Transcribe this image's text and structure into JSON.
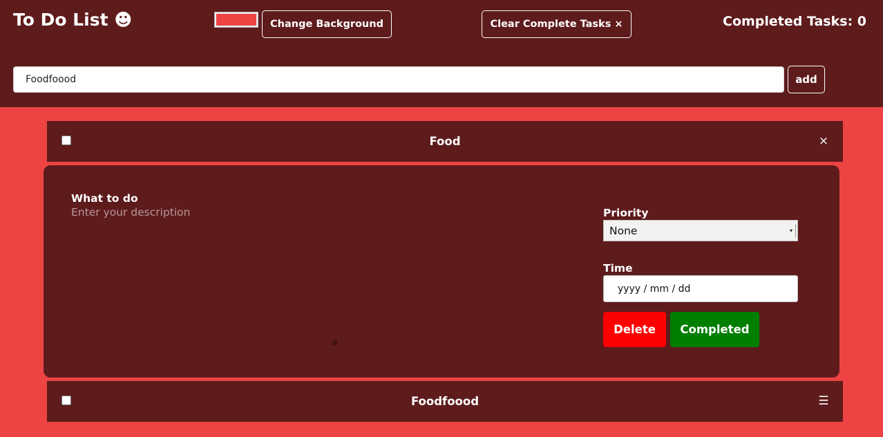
{
  "header": {
    "title": "To Do List ☻",
    "color_picker_value": "#ee4343",
    "change_background_label": "Change Background",
    "clear_complete_label": "Clear Complete Tasks",
    "clear_icon": "×",
    "completed_count_text": "Completed Tasks: 0"
  },
  "new_task": {
    "value": "Foodfoood",
    "add_label": "add"
  },
  "tasks": [
    {
      "title": "Food",
      "checked": false,
      "icon": "close-icon",
      "icon_glyph": "×",
      "expanded": true
    },
    {
      "title": "Foodfoood",
      "checked": false,
      "icon": "menu-icon",
      "icon_glyph": "☰",
      "expanded": false
    }
  ],
  "details": {
    "description_label": "What to do",
    "description_placeholder": "Enter your description",
    "priority_label": "Priority",
    "priority_value": "None",
    "time_label": "Time",
    "time_placeholder": "yyyy / mm / dd",
    "delete_label": "Delete",
    "completed_label": "Completed"
  },
  "colors": {
    "page_background": "#ee4343",
    "panel_background": "#5e1b1c",
    "delete": "#fd0000",
    "completed": "#007e00"
  }
}
